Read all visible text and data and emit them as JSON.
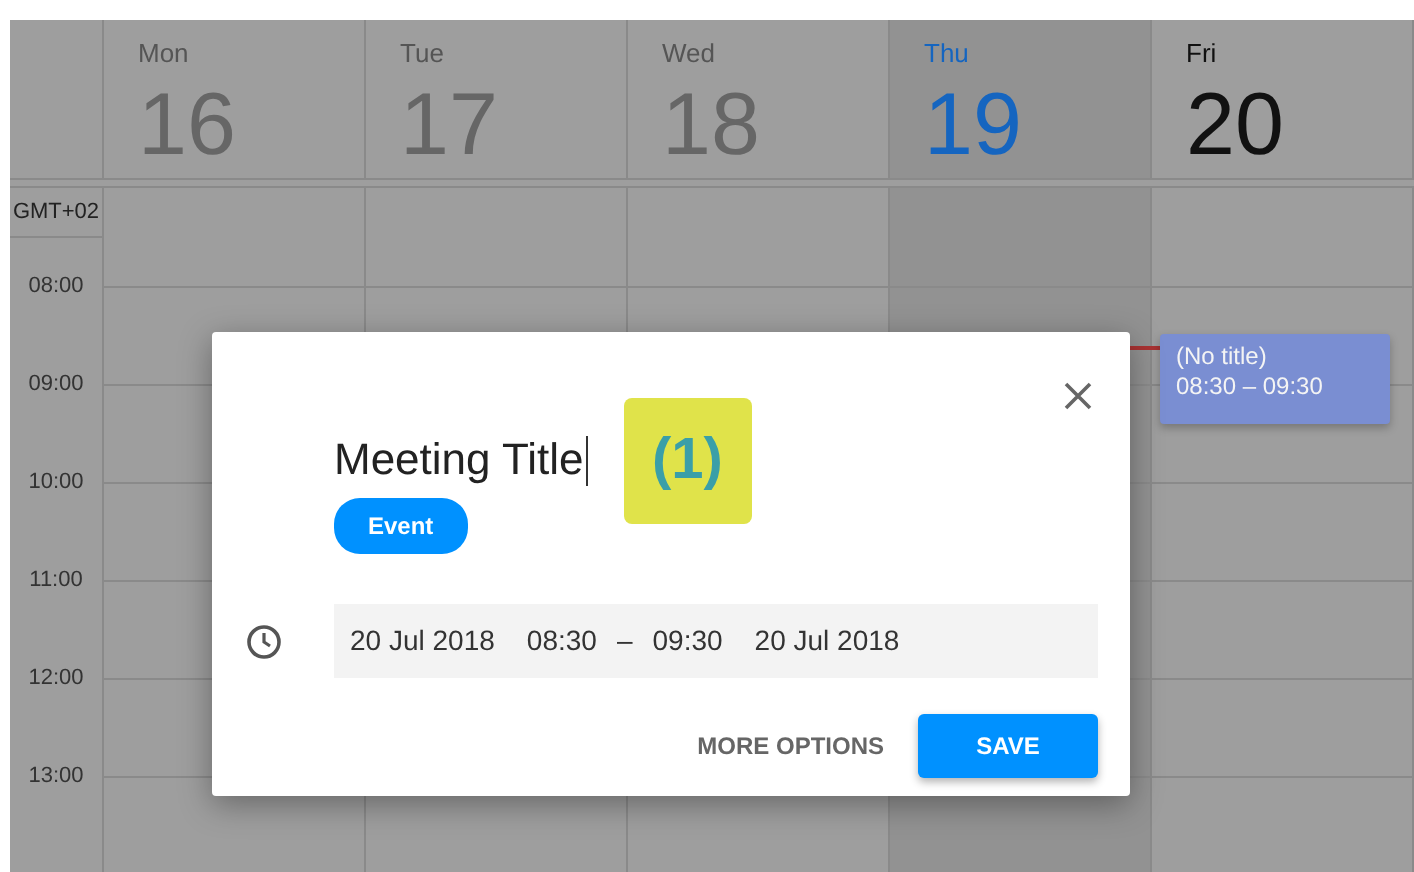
{
  "days": [
    {
      "name": "Mon",
      "number": "16",
      "today": false,
      "selected": false
    },
    {
      "name": "Tue",
      "number": "17",
      "today": false,
      "selected": false
    },
    {
      "name": "Wed",
      "number": "18",
      "today": false,
      "selected": false
    },
    {
      "name": "Thu",
      "number": "19",
      "today": true,
      "selected": false
    },
    {
      "name": "Fri",
      "number": "20",
      "today": false,
      "selected": true
    }
  ],
  "timezone": "GMT+02",
  "hours": [
    "08:00",
    "09:00",
    "10:00",
    "11:00",
    "12:00",
    "13:00"
  ],
  "event": {
    "title": "(No title)",
    "time": "08:30 – 09:30"
  },
  "dialog": {
    "title": "Meeting Title",
    "annotation": "(1)",
    "chip": "Event",
    "start_date": "20 Jul 2018",
    "start_time": "08:30",
    "separator": "–",
    "end_time": "09:30",
    "end_date": "20 Jul 2018",
    "buttons": [
      {
        "label": "MORE OPTIONS",
        "kind": "text"
      },
      {
        "label": "SAVE",
        "kind": "primary"
      }
    ]
  }
}
